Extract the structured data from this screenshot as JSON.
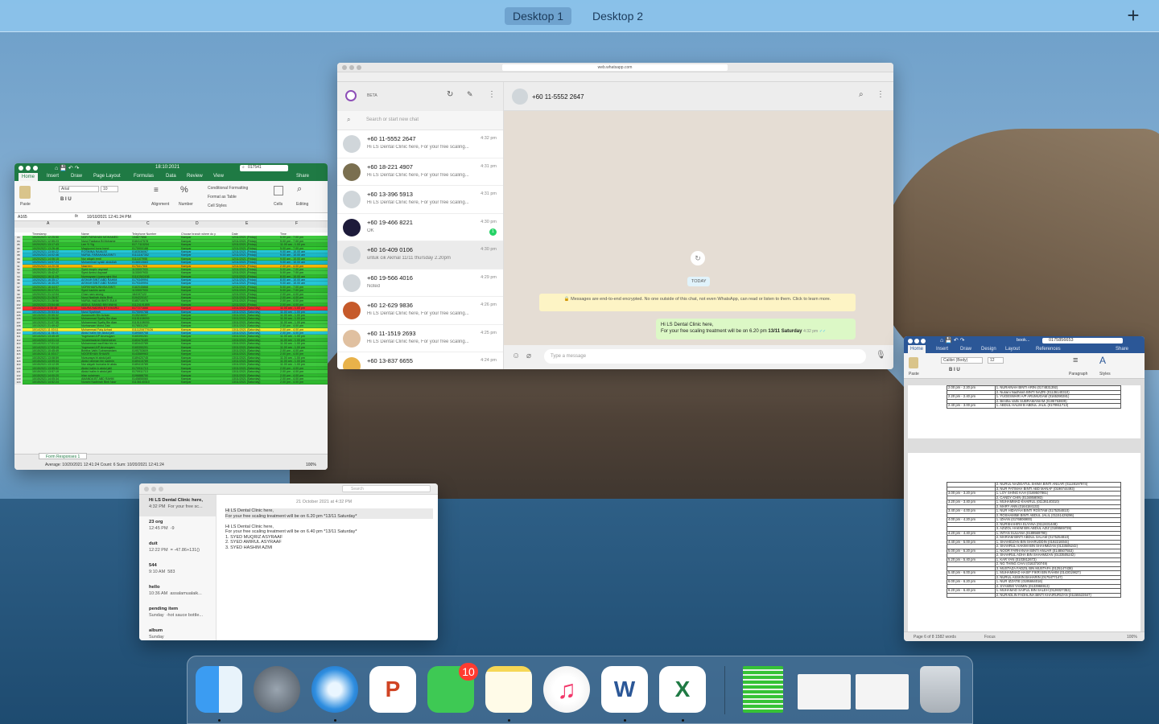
{
  "mission_control": {
    "desktops": [
      "Desktop 1",
      "Desktop 2"
    ],
    "add_icon": "+"
  },
  "excel": {
    "title": "18:10:2021",
    "search": "017541",
    "share": "Share",
    "tabs": [
      "Home",
      "Insert",
      "Draw",
      "Page Layout",
      "Formulas",
      "Data",
      "Review",
      "View"
    ],
    "font": "Arial",
    "font_size": "10",
    "tool_labels": [
      "Paste",
      "Alignment",
      "Number",
      "Cells",
      "Editing"
    ],
    "styles": [
      "Conditional Formatting",
      "Format as Table",
      "Cell Styles"
    ],
    "cell_ref": "A165",
    "formula": "10/10/2021 12:41:24 PM",
    "columns": [
      "A",
      "B",
      "C",
      "D",
      "E",
      "F"
    ],
    "headers": [
      "Timestamp",
      "Name",
      "Telephone Number",
      "Choose branch where do y",
      "Date",
      "Time"
    ],
    "rows": [
      [
        "10/20/2021 12:25:50",
        "NOR FARAHAN MOHAMED",
        "134677858",
        "Kampar",
        "12/11/2021 (Friday)",
        "5.00 pm - 7.00 pm"
      ],
      [
        "10/20/2021 12:55:23",
        "Nurul Fasliana Bt Mohame",
        "0184147578",
        "Kampar",
        "12/11/2021 (Friday)",
        "5.00 pm - 7.00 pm"
      ],
      [
        "10/20/2021 13:17:43",
        "Lee Yi Yig",
        "017-7113204",
        "Kampar",
        "12/11/2021 (Friday)",
        "11.00 am - 1.00 pm"
      ],
      [
        "10/20/2021 13:26:48",
        "Magipunni bonz bond",
        "0175900188",
        "Kampar",
        "12/11/2021 (Friday)",
        "5.00 pm - 7.00 pm"
      ],
      [
        "10/20/2021 13:50:22",
        "ROSMINA RAMLEE",
        "0183536067",
        "Kampar",
        "12/11/2021 (Friday)",
        "9.00 am - 10.00 am"
      ],
      [
        "10/20/2021 14:02:46",
        "NURUL FARAHANA BINTI",
        "01111167352",
        "Kampar",
        "12/11/2021 (Friday)",
        "9.00 am - 10.00 am"
      ],
      [
        "10/20/2021 14:06:15",
        "Nur atiqah renti",
        "0111107955",
        "Kampar",
        "12/11/2021 (Friday)",
        "9.00 am - 10.00 am"
      ],
      [
        "10/20/2021 14:07:24",
        "Muhammad syakir abdullah",
        "0136510683",
        "Kampar",
        "12/11/2021 (Friday)",
        "9.00 am - 10.00 am"
      ],
      [
        "10/20/2021 14:20:28",
        "Nazreen",
        "01754178/8",
        "Kampar",
        "12/11/2021 (Friday)",
        "2.00 pm - 4.00 pm"
      ],
      [
        "10/20/2021 15:20:22",
        "Syed muqriz asyraaf",
        "1133007933",
        "Kampar",
        "12/11/2021 (Friday)",
        "5.00 pm - 7.00 pm"
      ],
      [
        "10/20/2021 15:42:47",
        "Syed Amirul Asyraaf",
        "1133007933",
        "Kampar",
        "12/11/2021 (Friday)",
        "5.00 pm - 7.00 pm"
      ],
      [
        "10/20/2021 16:11:29",
        "Nurmuyzan Liyana sjmi Mol",
        "01110342436",
        "Kampar",
        "12/11/2021 (Friday)",
        "8.00 am - 10.00 am"
      ],
      [
        "10/20/2021 16:35:17",
        "AISHAH BINTI ABD RAHIM",
        "0179349994",
        "Kampar",
        "12/11/2021 (Friday)",
        "8.00 am - 10.00 am"
      ],
      [
        "10/20/2021 16:35:29",
        "AISHAH BINTI ABD RAHIM",
        "0179349994",
        "Kampar",
        "12/11/2021 (Friday)",
        "9.00 am - 10.00 am"
      ],
      [
        "10/20/2021 16:44:07",
        "NORKHAIRUNNISA BINTI",
        "0182045868",
        "Kampar",
        "12/11/2021 (Friday)",
        "5.00 pm - 7.00 pm"
      ],
      [
        "10/20/2021 20:17:21",
        "Syed hashim azmi",
        "1133007933",
        "Kampar",
        "12/11/2021 (Friday)",
        "5.00 pm - 7.00 pm"
      ],
      [
        "10/20/2021 21:12:04",
        "Chan nam seong",
        "164197122",
        "Kampar",
        "12/11/2021 (Friday)",
        "2.00 pm - 4.00 pm"
      ],
      [
        "10/20/2021 21:26:57",
        "Nurul Nadirah Asila Binti",
        "0194220107",
        "Kampar",
        "12/11/2021 (Friday)",
        "2.00 pm - 4.00 pm"
      ],
      [
        "10/20/2021 21:28:56",
        "NURUL NADIA BINTI ZULK",
        "0185710078",
        "Kampar",
        "12/11/2021 (Friday)",
        "2.00 pm - 4.00 pm"
      ],
      [
        "10/20/2021 23:54:48",
        "ABDUL SAMAD BIN WAHA",
        "01124191859",
        "Kampar",
        "12/11/2021 (Friday)",
        "2.00 pm - 4.00 pm"
      ],
      [
        "10/13/2021 8:30:48",
        "NAURA NADIRA BT KHAIRU",
        "0177271666",
        "Kampar",
        "13/11/2021 (Saturday)",
        "11.00 am - 1.00 pm"
      ],
      [
        "10/13/2021 20:53:34",
        "Nurul Syahirah",
        "0175590788",
        "Kampar",
        "13/11/2021 (Saturday)",
        "11.00 am - 1.00 pm"
      ],
      [
        "10/13/2021 20:55:32",
        "Aswanudin Bin Azizan",
        "0135246007",
        "Kampar",
        "13/11/2021 (Saturday)",
        "11.00 am - 1.00 pm"
      ],
      [
        "10/13/2021 21:06:56",
        "Muhammad Syafiq Bin Alan",
        "01151108939",
        "Kampar",
        "13/11/2021 (Saturday)",
        "11.00 am - 1.00 pm"
      ],
      [
        "10/13/2021 21:07:35",
        "Muhammad Syafiq Bin Alan",
        "01151108939",
        "Kampar",
        "13/11/2021 (Saturday)",
        "11.00 am - 1.00 pm"
      ],
      [
        "10/13/2021 21:49:42",
        "Nurhazwan Mohd Zaki",
        "0178531292",
        "Kampar",
        "13/11/2021 (Saturday)",
        "2.00 pm - 4.00 pm"
      ],
      [
        "10/14/2021 11:03:11",
        "Muhammad Faiq Azhad",
        "01111206770/26",
        "Kampar",
        "13/11/2021 (Saturday)",
        "2.00 pm - 4.00 pm"
      ],
      [
        "10/14/2021 11:36:21",
        "Abdul halim bin abdul jalil",
        "0189569758",
        "Kampar",
        "13/11/2021 (Saturday)",
        "2.00 pm - 4.00 pm"
      ],
      [
        "10/14/2021 13:45:49",
        "Yugeswari A/P Arumugam",
        "0165390281",
        "Kampar",
        "13/11/2021 (Saturday)",
        "11.00 am - 1.00 pm"
      ],
      [
        "10/14/2021 14:01:14",
        "Yuvaneswaran Mahendran",
        "0183475189",
        "Kampar",
        "13/11/2021 (Saturday)",
        "11.00 am - 1.00 pm"
      ],
      [
        "10/14/2021 17:01:12",
        "Muhammad nazif faiz bin m",
        "0183443789",
        "Kampar",
        "13/11/2021 (Saturday)",
        "11.00 am - 1.00 pm"
      ],
      [
        "10/14/2021 17:03:19",
        "Yugeswari A/P Arumugam",
        "0165390291",
        "Kampar",
        "13/11/2021 (Saturday)",
        "11.00 am - 1.00 pm"
      ],
      [
        "10/15/2021 10:45:49",
        "Brintha Vathi Subramaniam",
        "0195753609",
        "Kampar",
        "13/11/2021 (Saturday)",
        "2.00 pm - 4.00 pm"
      ],
      [
        "10/15/2021 11:03:17",
        "NOOREHAN SHAARI",
        "0143589963",
        "Kampar",
        "13/11/2021 (Saturday)",
        "2.00 pm - 4.00 pm"
      ],
      [
        "10/15/2021 13:08:59",
        "Nursuraya bt abdul jalil",
        "0189420745",
        "Kampar",
        "13/11/2021 (Saturday)",
        "11.00 am - 1.00 pm"
      ],
      [
        "10/15/2021 13:09:34",
        "Abdul rahman bin sadmin",
        "0189415789",
        "Kampar",
        "13/11/2021 (Saturday)",
        "11.00 am - 1.00 pm"
      ],
      [
        "10/15/2021 13:12:39",
        "Nur aisyah humaira bt abdu",
        "0189415789",
        "Kampar",
        "13/11/2021 (Saturday)",
        "11.00 am - 1.00 pm"
      ],
      [
        "10/15/2021 13:55:52",
        "Abdul halim b abdul jalil",
        "0170911713",
        "Kampar",
        "13/11/2021 (Saturday)",
        "2.00 pm - 4.00 pm"
      ],
      [
        "10/15/2021 13:57:19",
        "Abdul halim b abdul jalil",
        "0170911713",
        "Kampar",
        "13/11/2021 (Saturday)",
        "2.00 pm - 4.00 pm"
      ],
      [
        "10/15/2021 14:00:20",
        "Irfan sulaiman",
        "0196888750",
        "Kampar",
        "13/11/2021 (Saturday)",
        "2.00 pm - 4.00 pm"
      ],
      [
        "10/15/2021 14:05:34",
        "AMANDA BT ABD RAHM",
        "0145855060",
        "Kampar",
        "13/11/2021 (Saturday)",
        "2.00 pm - 4.00 pm"
      ],
      [
        "10/15/2021 14:52:24",
        "Nuraini Nadhirah Binti Nazr",
        "01136140310",
        "Kampar",
        "13/11/2021 (Saturday)",
        "2.00 pm - 4.00 pm"
      ]
    ],
    "row_colors": [
      "#3ec93e",
      "#3ec93e",
      "#2eb82e",
      "#32c832",
      "#26c6d6",
      "#1ab8c8",
      "#3ec93e",
      "#1ab8c8",
      "#f5b800",
      "#3ec93e",
      "#3ec93e",
      "#2eb82e",
      "#26c6d6",
      "#26c6d6",
      "#3ec93e",
      "#2eb82e",
      "#3ec93e",
      "#2eb82e",
      "#3ec93e",
      "#2eb82e",
      "#f03030",
      "#1ab8c8",
      "#3ec93e",
      "#2eb82e",
      "#3ec93e",
      "#3ec93e",
      "#f2f230",
      "#26c6d6",
      "#3ec93e",
      "#2eb82e",
      "#3ec93e",
      "#2eb82e",
      "#3ec93e",
      "#2eb82e",
      "#3ec93e",
      "#2eb82e",
      "#3ec93e",
      "#2eb82e",
      "#3ec93e",
      "#2eb82e",
      "#3ec93e",
      "#2eb82e"
    ],
    "row_start": 83,
    "sheet_tab": "Form Responses 1",
    "status": "Average: 10/20/2021 12:41:24   Count: 6   Sum: 10/20/2021 12:41:24",
    "zoom": "100%"
  },
  "whatsapp": {
    "url": "web.whatsapp.com",
    "beta": "BETA",
    "search_placeholder": "Search or start new chat",
    "chats": [
      {
        "name": "+60 11-5552 2647",
        "time": "4:32 pm",
        "preview": "Hi LS Dental Clinic here,  For your free scaling..."
      },
      {
        "name": "+60 18-221 4907",
        "time": "4:31 pm",
        "preview": "Hi LS Dental Clinic here,  For your free scaling..."
      },
      {
        "name": "+60 13-396 5913",
        "time": "4:31 pm",
        "preview": "Hi LS Dental Clinic here,  For your free scaling..."
      },
      {
        "name": "+60 19-466 8221",
        "time": "4:30 pm",
        "preview": "OK",
        "unread": "1"
      },
      {
        "name": "+60 16-409 0106",
        "time": "4:30 pm",
        "preview": "untuk cik Akmal 11/11 thursday 2.20pm"
      },
      {
        "name": "+60 19-566 4016",
        "time": "4:29 pm",
        "preview": "Noted"
      },
      {
        "name": "+60 12-629 9836",
        "time": "4:26 pm",
        "preview": "Hi LS Dental Clinic here,  For your free scaling..."
      },
      {
        "name": "+60 11-1519 2693",
        "time": "4:25 pm",
        "preview": "Hi LS Dental Clinic here,  For your free scaling..."
      },
      {
        "name": "+60 13-837 6655",
        "time": "4:24 pm",
        "preview": ""
      }
    ],
    "active_chat": "+60 11-5552 2647",
    "today": "TODAY",
    "encryption": "Messages are end-to-end encrypted. No one outside of this chat, not even WhatsApp, can read or listen to them. Click to learn more.",
    "message_line1": "Hi LS Dental Clinic here,",
    "message_line2": "For your free scaling treatment will be on 6.20 pm",
    "message_bold": "13/11 Saturday",
    "message_time": "4:32 pm",
    "composer_placeholder": "Type a message"
  },
  "word": {
    "title": "book...",
    "search": "0175856653",
    "share": "Share",
    "tabs": [
      "Home",
      "Insert",
      "Draw",
      "Design",
      "Layout",
      "References"
    ],
    "font": "Calibri (Body)",
    "size": "12",
    "tool_labels": [
      "Paste",
      "Paragraph",
      "Styles"
    ],
    "page1_rows": [
      [
        "2.00 pm - 2.20 pm",
        "1. NURAINAH BINTI ARIN (0174831392)"
      ],
      [
        "",
        "2. Nuraini Nadhirah BINTI NAZRI (01136140310)"
      ],
      [
        "2.20 pm - 2.40 pm",
        "1. YUGESWARI A/P ARUMUGAM (0165390281)"
      ],
      [
        "",
        "2. Brintha Vathi SUBRAMANIAM (0195753609)"
      ],
      [
        "2.40 pm - 3.00 pm",
        "1. ABDUL HALIM B ABDUL JALIL (0170911713)"
      ]
    ],
    "page2_rows": [
      [
        "",
        "2. NURUL NAZIEATUL SHIMA BINTI ANUAR (01128197974)"
      ],
      [
        "",
        "3. NUR FATIMAH BINTI ABD MANAF (0196744493)"
      ],
      [
        "3.00 pm - 3.20 pm",
        "1. LOY SHING KAH (0169507861)"
      ],
      [
        "",
        "2. CANDY CHIN (0134858083)"
      ],
      [
        "3.20 pm - 3.40 pm",
        "1. MUHAMMAD KHAIRUL (01136140310)"
      ],
      [
        "",
        "2. MARY ANN (0164184132)"
      ],
      [
        "3.40 pm - 4.00 pm",
        "1. NUR HIDAYAH BINTI ROSTAM (0175254810)"
      ],
      [
        "",
        "2. ROSHAMIMI BINTI ABDUL JALIL (01151429296)"
      ],
      [
        "4.00 pm - 4.20 pm",
        "1. IZHAN (0176806900)"
      ],
      [
        "",
        "2. NURSHAHIRA ELYANA (0112431448)"
      ],
      [
        "",
        "3. AZIZOL HAKIM BIN ABDUL AZIZ (0189569739)"
      ],
      [
        "4.20 pm - 4.40 pm",
        "1. INTAN SULIANA (0189569790)"
      ],
      [
        "",
        "2. MARIAM BINTI ABDUL SALAM (0175254810)"
      ],
      [
        "4.40 pm - 5.00 pm",
        "1. SHAHIDZAN BIN SHARUDDIN (0192216044)"
      ],
      [
        "",
        "2. SHAHRUL HAKIMI BIN SHAHMIZAN (0133505242)"
      ],
      [
        "5.00 pm - 5.20 pm",
        "1. NOOR FARHANAH BINTI ANUAR (0148507553)"
      ],
      [
        "",
        "2. SHAHRUL ADHA BIN SHAHMIZAN (0133505242)"
      ],
      [
        "5.20 pm - 5.40 pm",
        "1. KAR YAN (0103812673)"
      ],
      [
        "",
        "2. NG THING CHAI (0163730749)"
      ],
      [
        "",
        "3. MUSTAZA FADZIL BIN MUSTAFA (0125147438)"
      ],
      [
        "5.40 pm - 6.00 pm",
        "1. MUHAMMAD HASIF FIKRI BIN RAHIM (0143019827)"
      ],
      [
        "",
        "2. NURUL ASSKIN BAHARIN (0175477147)"
      ],
      [
        "6.00 pm - 6.20 pm",
        "1. NUR IZZATIE (0195664016)"
      ],
      [
        "",
        "2. SYAMIMI YASMIN (0133966913)"
      ],
      [
        "6.20 pm - 6.40 pm",
        "1. MUHAMAD SAIFUL BIN SALEH (0126027353)"
      ],
      [
        "",
        "2. NURADLIN FADHLINA BINTI KHAIRURIZAN (01155522647)"
      ]
    ],
    "status": "Page 6 of 8     1582 words",
    "focus": "Focus",
    "zoom": "100%"
  },
  "notes": {
    "search_placeholder": "Search",
    "items": [
      {
        "title": "Hi LS Dental Clinic here,",
        "time": "4:32 PM",
        "snippet": "For your free sc..."
      },
      {
        "title": "23 org",
        "time": "12:45 PM",
        "snippet": "-9"
      },
      {
        "title": "duit",
        "time": "12:22 PM",
        "snippet": "= -47.86+131()"
      },
      {
        "title": "544",
        "time": "9:10 AM",
        "snippet": "583"
      },
      {
        "title": "hello",
        "time": "10:36 AM",
        "snippet": "assalamualaik..."
      },
      {
        "title": "pending item",
        "time": "Sunday",
        "snippet": "-hot sauce bottle..."
      },
      {
        "title": "album",
        "time": "Sunday",
        "snippet": ""
      }
    ],
    "date": "21 October 2021 at 4:32 PM",
    "body": [
      "Hi LS Dental Clinic here,",
      "For your free scaling treatment will be on 6.20 pm *13/11 Saturday*",
      "",
      "Hi LS Dental Clinic here,",
      "For your free scaling treatment will be on 6.40 pm *13/11 Saturday*",
      "1. SYED MUQRIZ ASYRAAF",
      "2. SYED AMIRUL ASYRAAF",
      "3. SYED HASHIM AZMI"
    ]
  },
  "dock": {
    "facetime_badge": "10"
  }
}
